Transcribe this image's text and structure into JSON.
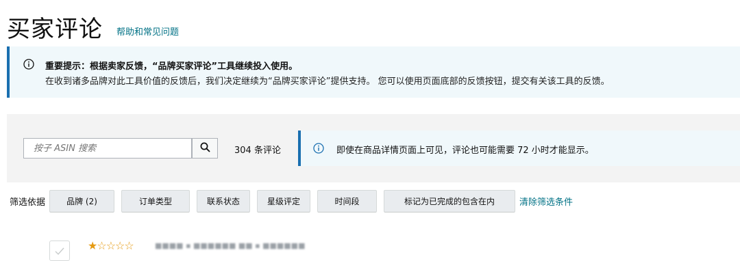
{
  "header": {
    "title": "买家评论",
    "help_link": "帮助和常见问题"
  },
  "notice": {
    "title": "重要提示：根据卖家反馈，“品牌买家评论”工具继续投入使用。",
    "body": "在收到诸多品牌对此工具价值的反馈后，我们决定继续为“品牌买家评论”提供支持。 您可以使用页面底部的反馈按钮，提交有关该工具的反馈。"
  },
  "search": {
    "placeholder": "按子 ASIN 搜索",
    "review_count": "304 条评论",
    "tip": "即使在商品详情页面上可见，评论也可能需要 72 小时才能显示。"
  },
  "filters": {
    "label": "筛选依据",
    "buttons": [
      "品牌 (2)",
      "订单类型",
      "联系状态",
      "星级评定",
      "时间段",
      "标记为已完成的包含在内"
    ],
    "clear_label": "清除筛选条件"
  },
  "reviews": [
    {
      "rating": 1,
      "max_rating": 5,
      "stars_filled": "★",
      "stars_empty": "☆☆☆☆",
      "title_blurred": "■■■■ ▪ ■■■■■■ ■■ ▪ ■■■■■■"
    }
  ],
  "colors": {
    "link": "#007185",
    "notice_bg": "#f0f8fb",
    "notice_border": "#1a6fb0",
    "panel_bg": "#f3f3f3",
    "star": "#e59a12"
  }
}
